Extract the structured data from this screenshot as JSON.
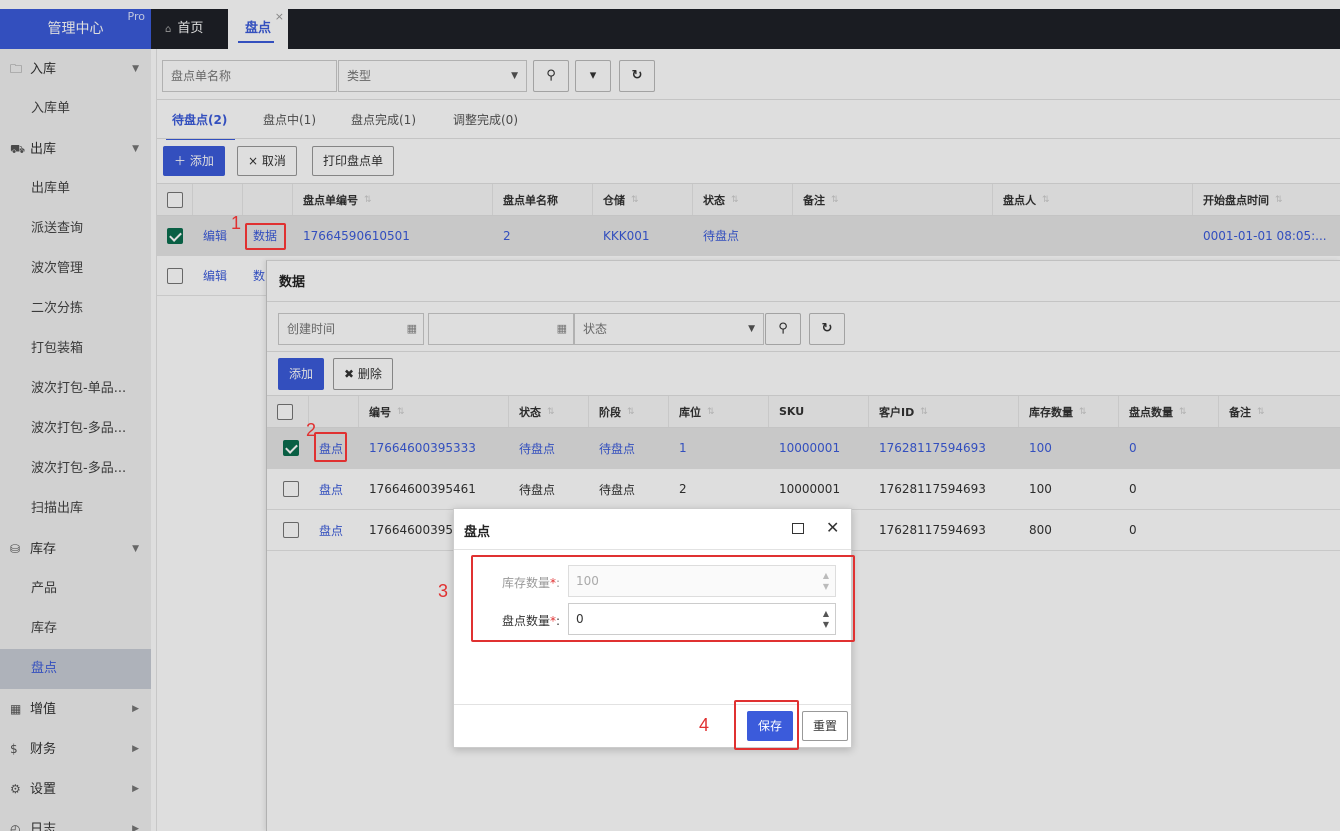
{
  "brand": {
    "title": "管理中心",
    "badge": "Pro"
  },
  "tabs": {
    "home": "首页",
    "current": "盘点",
    "close": "×"
  },
  "sidebar": {
    "groups": [
      {
        "label": "入库",
        "icon": "inbox-icon"
      },
      {
        "label": "出库",
        "icon": "truck-icon"
      },
      {
        "label": "库存",
        "icon": "cubes-icon"
      },
      {
        "label": "增值",
        "icon": "grid-icon"
      },
      {
        "label": "财务",
        "icon": "dollar-icon"
      },
      {
        "label": "设置",
        "icon": "gears-icon"
      },
      {
        "label": "日志",
        "icon": "clock-icon"
      }
    ],
    "items": [
      "入库单",
      "出库单",
      "派送查询",
      "波次管理",
      "二次分拣",
      "打包装箱",
      "波次打包-单品...",
      "波次打包-多品...",
      "波次打包-多品...",
      "扫描出库",
      "产品",
      "库存",
      "盘点"
    ],
    "group_icons": {
      "inbox": "🗀",
      "truck": "⛟",
      "cubes": "⛁",
      "grid": "▦",
      "dollar": "$",
      "gears": "⚙",
      "clock": "◴"
    }
  },
  "search": {
    "name_placeholder": "盘点单名称",
    "type_placeholder": "类型"
  },
  "subtabs": [
    "待盘点(2)",
    "盘点中(1)",
    "盘点完成(1)",
    "调整完成(0)"
  ],
  "toolbar": {
    "add": "＋ 添加",
    "cancel": "× 取消",
    "print": "打印盘点单"
  },
  "table": {
    "headers": [
      "盘点单编号",
      "盘点单名称",
      "仓储",
      "状态",
      "备注",
      "盘点人",
      "开始盘点时间"
    ],
    "rows": [
      {
        "edit": "编辑",
        "data": "数据",
        "code": "17664590610501",
        "name": "2",
        "warehouse": "KKK001",
        "status": "待盘点",
        "note": "",
        "person": "",
        "start": "0001-01-01 08:05:..."
      },
      {
        "edit": "编辑",
        "data": "数"
      }
    ]
  },
  "panel": {
    "title": "数据",
    "created_placeholder": "创建时间",
    "status_placeholder": "状态",
    "add": "添加",
    "delete": "✖ 删除",
    "headers": [
      "编号",
      "状态",
      "阶段",
      "库位",
      "SKU",
      "客户ID",
      "库存数量",
      "盘点数量",
      "备注"
    ],
    "rows": [
      {
        "action": "盘点",
        "code": "17664600395333",
        "status": "待盘点",
        "stage": "待盘点",
        "loc": "1",
        "sku": "10000001",
        "cust": "17628117594693",
        "stock": "100",
        "count": "0"
      },
      {
        "action": "盘点",
        "code": "17664600395461",
        "status": "待盘点",
        "stage": "待盘点",
        "loc": "2",
        "sku": "10000001",
        "cust": "17628117594693",
        "stock": "100",
        "count": "0"
      },
      {
        "action": "盘点",
        "code": "17664600395",
        "status": "",
        "stage": "",
        "loc": "",
        "sku": "",
        "cust": "17628117594693",
        "stock": "800",
        "count": "0"
      }
    ]
  },
  "dialog": {
    "title": "盘点",
    "stock_label": "库存数量",
    "count_label": "盘点数量",
    "required": "*",
    "colon": ":",
    "stock_value": "100",
    "count_value": "0",
    "save": "保存",
    "reset": "重置"
  },
  "annotations": [
    "1",
    "2",
    "3",
    "4"
  ],
  "colors": {
    "primary": "#3b5bdb",
    "topbar": "#1e2128",
    "highlight": "#e03131",
    "checkbox": "#0b6e4f"
  }
}
